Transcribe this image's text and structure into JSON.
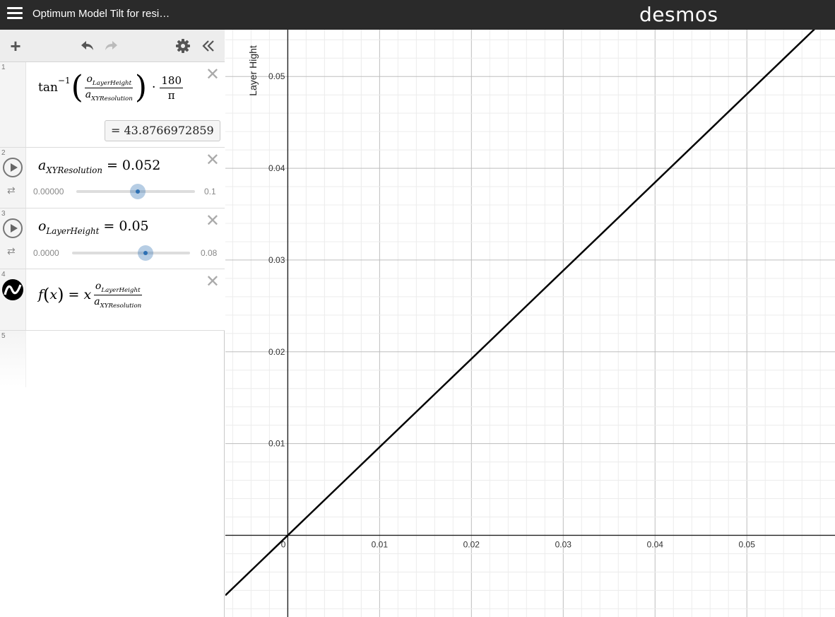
{
  "header": {
    "title": "Optimum Model Tilt for resi…",
    "brand": "desmos"
  },
  "expressions": [
    {
      "num": "1",
      "type": "expression",
      "result": "=  43.8766972859"
    },
    {
      "num": "2",
      "type": "slider",
      "var": "a",
      "sub": "XYResolution",
      "value": "0.052",
      "min": "0.00000",
      "max": "0.1",
      "fraction": 0.52
    },
    {
      "num": "3",
      "type": "slider",
      "var": "o",
      "sub": "LayerHeight",
      "value": "0.05",
      "min": "0.0000",
      "max": "0.08",
      "fraction": 0.625
    },
    {
      "num": "4",
      "type": "function",
      "color": "#000000"
    },
    {
      "num": "5",
      "type": "empty"
    }
  ],
  "graph": {
    "y_axis_label": "Layer Hight",
    "x_ticks": [
      "0",
      "0.01",
      "0.02",
      "0.03",
      "0.04",
      "0.05",
      "0"
    ],
    "y_ticks": [
      "0.01",
      "0.02",
      "0.03",
      "0.04",
      "0.05"
    ],
    "line_color": "#000000"
  },
  "chart_data": {
    "type": "line",
    "series": [
      {
        "name": "f(x)",
        "slope": 0.9615384615
      }
    ],
    "xlim": [
      -0.0068,
      0.0596
    ],
    "ylim": [
      -0.0089,
      0.0551
    ],
    "grid": true
  }
}
